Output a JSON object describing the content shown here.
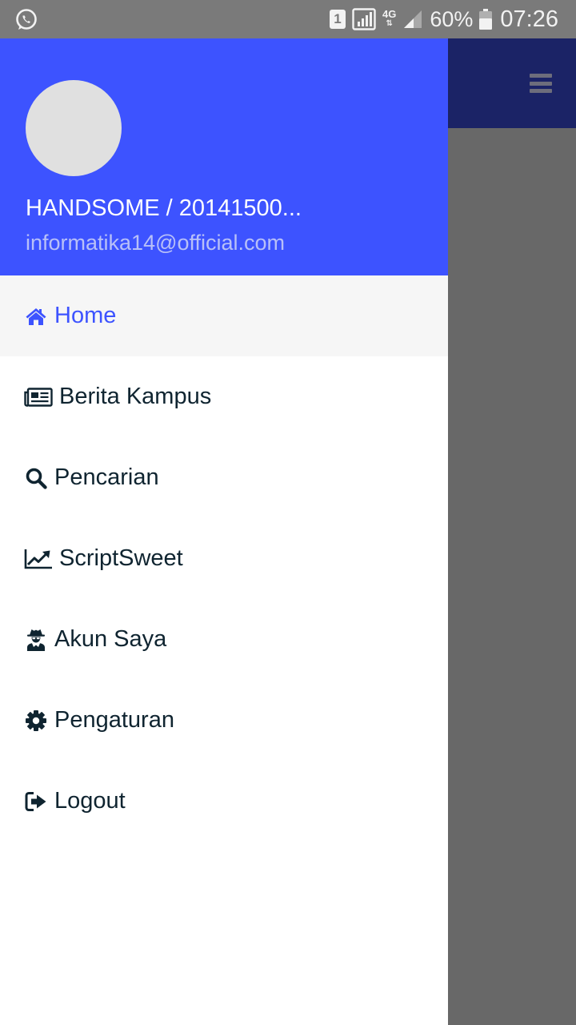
{
  "status_bar": {
    "sim_slot": "1",
    "network": "4G",
    "battery": "60%",
    "time": "07:26",
    "icons": [
      "whatsapp-icon",
      "sim-icon",
      "signal-icon",
      "mobile-data-icon",
      "battery-icon"
    ]
  },
  "colors": {
    "drawer_header": "#3d53ff",
    "active_item": "#3d53ff",
    "toolbar": "#1b2366",
    "scrim": "#686868"
  },
  "drawer": {
    "user_name": "HANDSOME / 20141500...",
    "user_email": "informatika14@official.com",
    "items": [
      {
        "label": "Home",
        "icon": "home-icon",
        "active": true
      },
      {
        "label": "Berita Kampus",
        "icon": "newspaper-icon",
        "active": false
      },
      {
        "label": "Pencarian",
        "icon": "search-icon",
        "active": false
      },
      {
        "label": "ScriptSweet",
        "icon": "line-chart-icon",
        "active": false
      },
      {
        "label": "Akun Saya",
        "icon": "user-secret-icon",
        "active": false
      },
      {
        "label": "Pengaturan",
        "icon": "gear-icon",
        "active": false
      },
      {
        "label": "Logout",
        "icon": "sign-out-icon",
        "active": false
      }
    ]
  }
}
